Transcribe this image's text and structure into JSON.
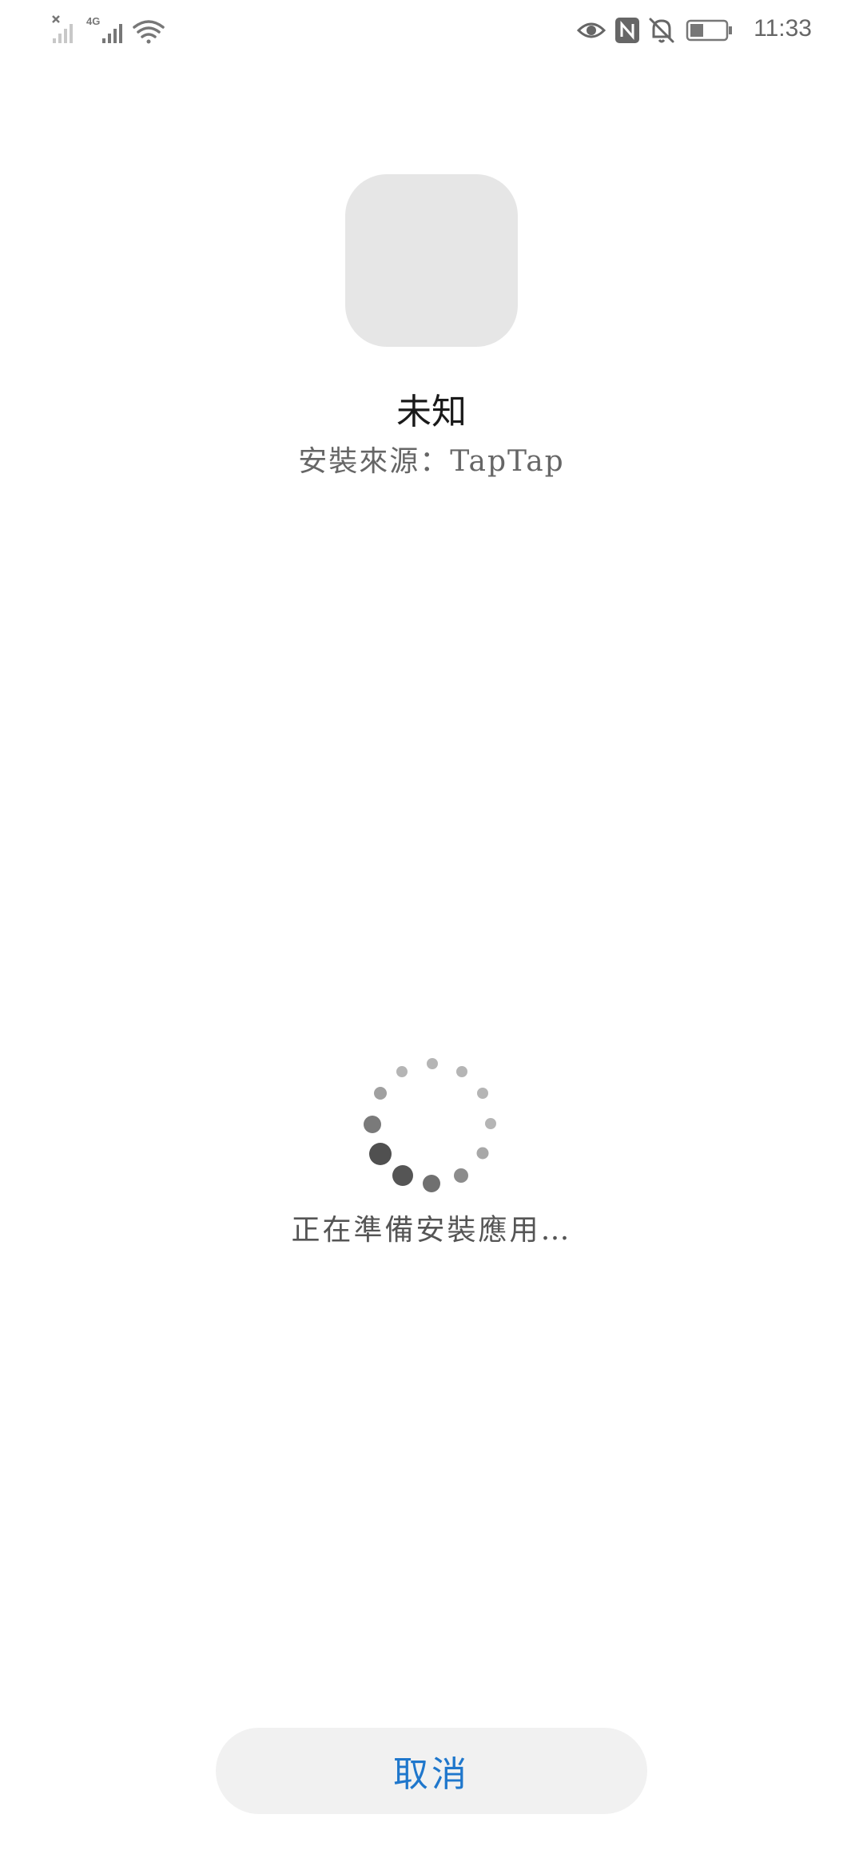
{
  "status_bar": {
    "network_label": "4G",
    "time": "11:33",
    "icons": [
      "no-signal-icon",
      "signal-icon",
      "wifi-icon",
      "eye-icon",
      "nfc-icon",
      "mute-icon",
      "battery-icon"
    ]
  },
  "app": {
    "name": "未知",
    "install_source": "安裝來源：TapTap"
  },
  "loading": {
    "text": "正在準備安裝應用…"
  },
  "actions": {
    "cancel_label": "取消"
  },
  "colors": {
    "accent": "#1f77cc",
    "icon_placeholder": "#e6e6e6",
    "button_bg": "#f1f1f1"
  }
}
